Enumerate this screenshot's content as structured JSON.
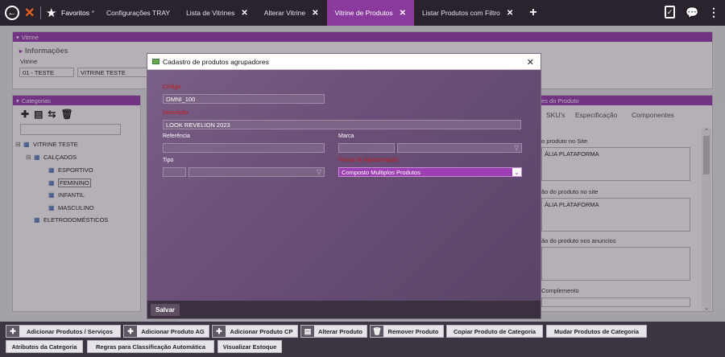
{
  "topbar": {
    "favorites_label": "Favoritos",
    "tabs": [
      {
        "label": "Configurações TRAY",
        "closable": false
      },
      {
        "label": "Lista de Vitrines",
        "closable": true
      },
      {
        "label": "Alterar Vitrine",
        "closable": true
      },
      {
        "label": "Vitrine de Produtos",
        "closable": true,
        "active": true
      },
      {
        "label": "Listar Produtos com Filtro",
        "closable": true
      }
    ],
    "add_symbol": "+"
  },
  "vitrine": {
    "header": "Vitrine",
    "section_label": "Informações",
    "field_label": "Vitrine",
    "code": "01 - TESTE",
    "name": "VITRINE TESTE"
  },
  "categorias": {
    "header": "Categorias",
    "tree": [
      {
        "label": "VITRINE TESTE",
        "toggle": "⊟"
      },
      {
        "label": "CALÇADOS",
        "toggle": "⊟"
      },
      {
        "label": "ESPORTIVO"
      },
      {
        "label": "FEMININO"
      },
      {
        "label": "INFANTIL"
      },
      {
        "label": "MASCULINO"
      },
      {
        "label": "ELETRODOMÉSTICOS"
      }
    ]
  },
  "produto": {
    "header_fragment": "es do Produto",
    "tabs": [
      "SKU's",
      "Especificação",
      "Componentes"
    ],
    "field1_label": "o produto no Site",
    "field1_value": "ÁLIA PLATAFORMA",
    "field2_label": "ão do produto no site",
    "field2_value": "ÁLIA PLATAFORMA",
    "field3_label": "ão do produto nos anuncios",
    "field4_label": "Complemento"
  },
  "dialog": {
    "title": "Cadastro de produtos agrupadores",
    "codigo_label": "Código",
    "codigo_value": "OMNI_100",
    "descricao_label": "Descrição",
    "descricao_value": "LOOK REVELION 2023",
    "referencia_label": "Referência",
    "marca_label": "Marca",
    "tipo_label": "Tipo",
    "forma_label": "Forma de Apresentação",
    "forma_value": "Composto Multiplos Produtos",
    "save_label": "Salvar"
  },
  "bottombar": {
    "buttons": [
      "Adicionar Produtos / Serviços",
      "Adicionar Produto AG",
      "Adicionar Produto CP",
      "Alterar Produto",
      "Remover Produto",
      "Copiar Produto de Categoria",
      "Mudar Produtos de Categoria",
      "Atributos da Categoria",
      "Regras para Classificação Automática",
      "Visualizar Estoque"
    ]
  }
}
